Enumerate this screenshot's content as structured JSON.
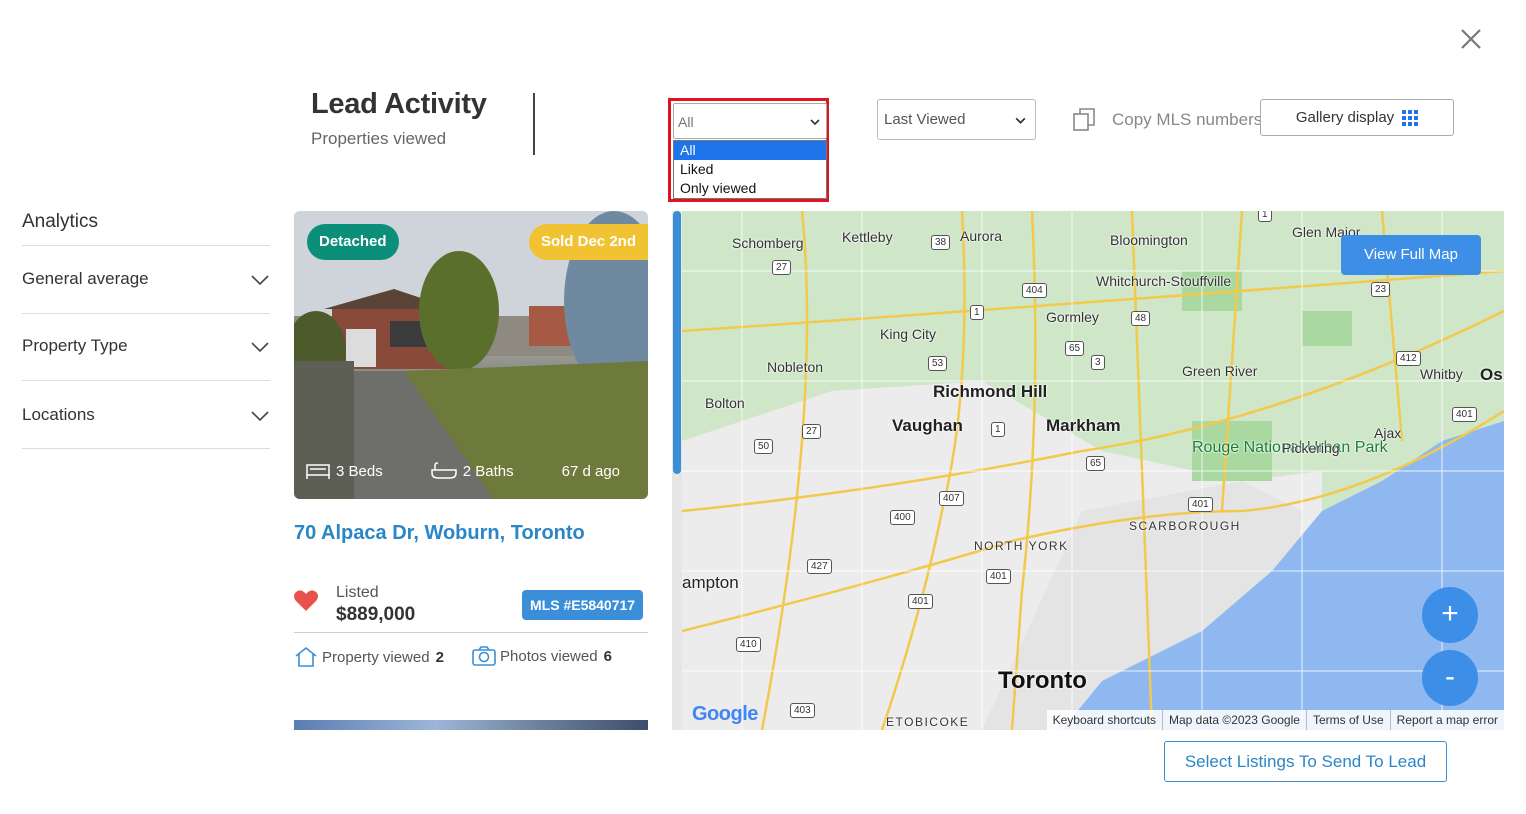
{
  "header": {
    "title": "Lead Activity",
    "subtitle": "Properties viewed",
    "close_icon": "close-icon"
  },
  "toolbar": {
    "filter": {
      "selected": "All",
      "options": [
        "All",
        "Liked",
        "Only viewed"
      ],
      "highlight_color": "#e0141e"
    },
    "sort": {
      "selected": "Last Viewed"
    },
    "copy_mls_label": "Copy MLS numbers",
    "gallery_label": "Gallery display"
  },
  "sidebar": {
    "heading": "Analytics",
    "items": [
      {
        "label": "General average"
      },
      {
        "label": "Property Type"
      },
      {
        "label": "Locations"
      }
    ]
  },
  "card": {
    "type_badge": "Detached",
    "status_badge": "Sold Dec 2nd",
    "beds": "3 Beds",
    "baths": "2 Baths",
    "age": "67 d ago",
    "address": "70 Alpaca Dr, Woburn, Toronto",
    "listed_label": "Listed",
    "price": "$889,000",
    "mls": "MLS #E5840717",
    "property_viewed_label": "Property viewed",
    "property_viewed_count": "2",
    "photos_viewed_label": "Photos viewed",
    "photos_viewed_count": "6",
    "colors": {
      "type_badge": "#0b8f7a",
      "status_badge": "#f1c232",
      "address": "#2b86c5",
      "heart": "#e8524a"
    }
  },
  "map": {
    "view_full_label": "View Full Map",
    "zoom_in": "+",
    "zoom_out": "-",
    "places": {
      "schomberg": "Schomberg",
      "kettleby": "Kettleby",
      "aurora": "Aurora",
      "bloomington": "Bloomington",
      "glen_major": "Glen Major",
      "whitchurch": "Whitchurch-Stouffville",
      "gormley": "Gormley",
      "king_city": "King City",
      "nobleton": "Nobleton",
      "richmond_hill": "Richmond Hill",
      "green_river": "Green River",
      "whitby": "Whitby",
      "os": "Os",
      "bolton": "Bolton",
      "vaughan": "Vaughan",
      "markham": "Markham",
      "rouge_park": "Rouge National Urban Park",
      "pickering": "Pickering",
      "ajax": "Ajax",
      "scarborough": "SCARBOROUGH",
      "north_york": "NORTH YORK",
      "brampton": "ampton",
      "toronto": "Toronto",
      "etobicoke": "ETOBICOKE"
    },
    "shields": {
      "s27a": "27",
      "s38": "38",
      "s404": "404",
      "s1a": "1",
      "s48": "48",
      "s23": "23",
      "s65a": "65",
      "s3": "3",
      "s53": "53",
      "s412": "412",
      "s401a": "401",
      "s50": "50",
      "s27b": "27",
      "s1b": "1",
      "s65b": "65",
      "s401b": "401",
      "s407": "407",
      "s400": "400",
      "s427": "427",
      "s401c": "401",
      "s401d": "401",
      "s410": "410",
      "s403": "403",
      "s1c": "1"
    },
    "google_logo": "Google",
    "attribution": [
      "Keyboard shortcuts",
      "Map data ©2023 Google",
      "Terms of Use",
      "Report a map error"
    ]
  },
  "footer": {
    "send_label": "Select Listings To Send To Lead"
  }
}
